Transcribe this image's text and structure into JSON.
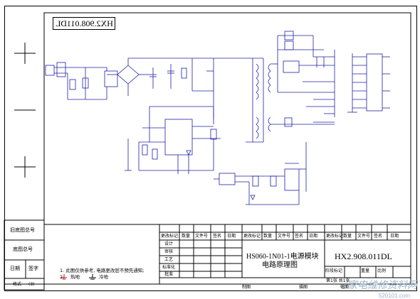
{
  "drawing_no": "HX2.908.011DL",
  "left_margin": {
    "old_drawing_no": "旧底图总号",
    "base_drawing_no": "底图总号",
    "date": "日期",
    "sign": "签字",
    "format": "格式",
    "format_value": "(3)"
  },
  "title_block": {
    "rev_mark": "更改标记",
    "qty": "数量",
    "doc_no": "文件号",
    "sign": "签名",
    "date": "日期",
    "design": "设计",
    "review": "审核",
    "process": "工艺",
    "standardize": "标准化",
    "approve": "批准",
    "product_title": "HS060-1N01-1电源模块",
    "product_subtitle": "电路原理图",
    "drawing_no": "HX2.908.011DL",
    "stage_mark": "阶段标记",
    "weight": "重量",
    "scale": "比例",
    "sheet": "第1张 共1张",
    "drafter": "制图",
    "describe": "描图",
    "size": "幅面"
  },
  "notes": {
    "line1": "1. 此图仅供参考, 电路更改恕不预先通知;",
    "line2_prefix": "2.",
    "hot_ground": "热地",
    "cold_ground": "冷地"
  },
  "watermark": {
    "text": "家电维修资料网",
    "url": "520101.com"
  }
}
